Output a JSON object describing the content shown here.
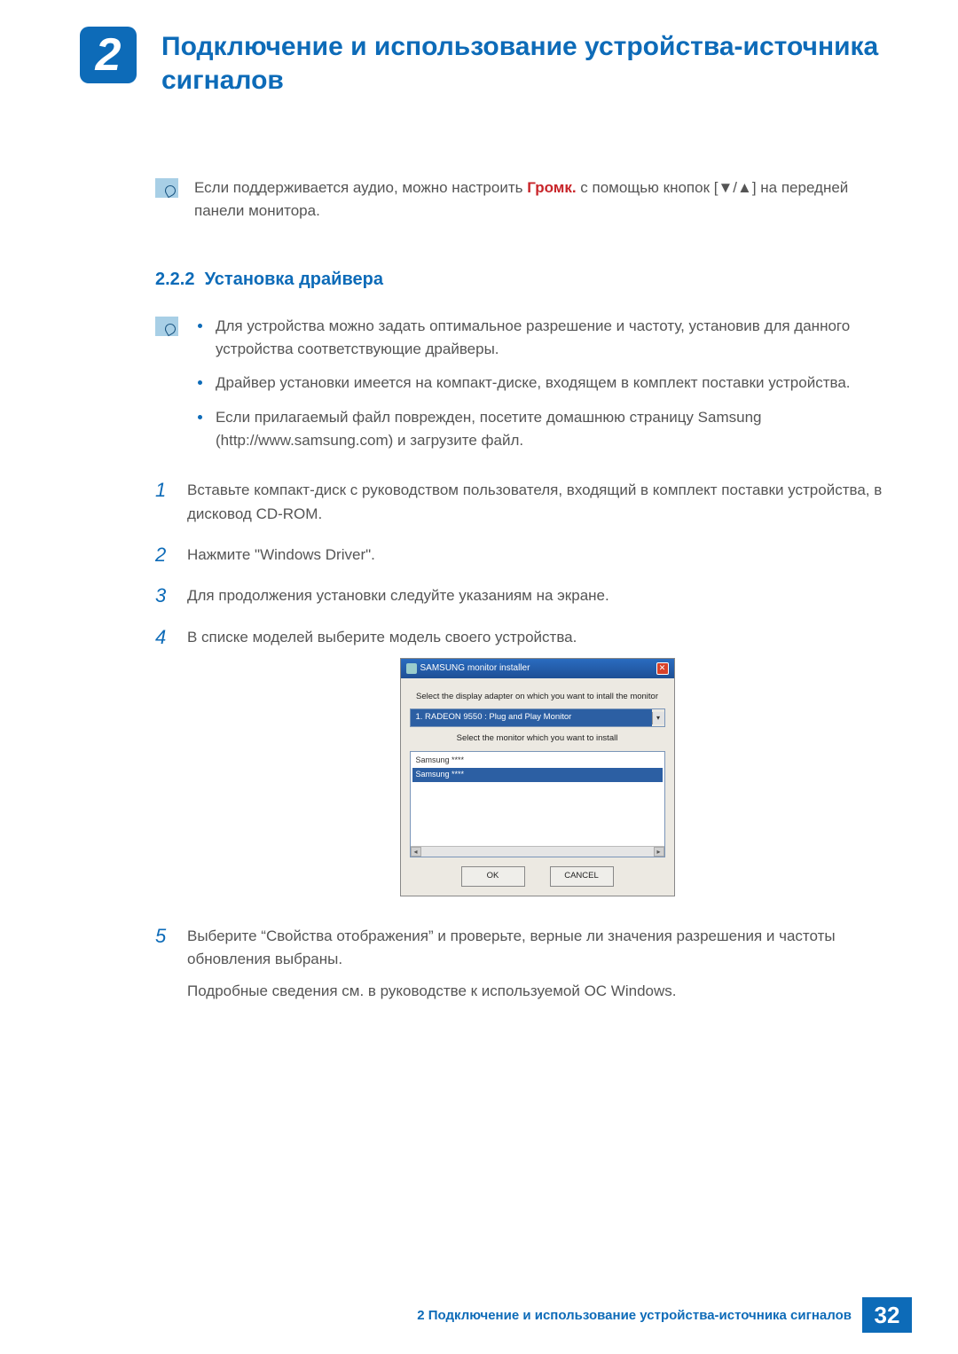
{
  "chapter": {
    "number": "2",
    "title": "Подключение и использование устройства-источника сигналов"
  },
  "intro_note": {
    "before": "Если поддерживается аудио, можно настроить ",
    "bold": "Громк.",
    "after_bold": " с помощью кнопок [",
    "symbols": "▼/▲",
    "end": "] на передней панели монитора."
  },
  "section": {
    "number": "2.2.2",
    "title": "Установка драйвера"
  },
  "bullets": [
    "Для устройства можно задать оптимальное разрешение и частоту, установив для данного устройства соответствующие драйверы.",
    "Драйвер установки имеется на компакт-диске, входящем в комплект поставки устройства.",
    "Если прилагаемый файл поврежден, посетите домашнюю страницу Samsung (http://www.samsung.com) и загрузите файл."
  ],
  "steps": [
    {
      "n": "1",
      "text": "Вставьте компакт-диск с руководством пользователя, входящий в комплект поставки устройства, в дисковод CD-ROM."
    },
    {
      "n": "2",
      "text": "Нажмите \"Windows Driver\"."
    },
    {
      "n": "3",
      "text": "Для продолжения установки следуйте указаниям на экране."
    },
    {
      "n": "4",
      "text": "В списке моделей выберите модель своего устройства."
    },
    {
      "n": "5",
      "text": "Выберите “Свойства отображения” и проверьте, верные ли значения разрешения и частоты обновления выбраны.",
      "extra": "Подробные сведения см. в руководстве к используемой ОС Windows."
    }
  ],
  "dialog": {
    "title": "SAMSUNG monitor installer",
    "label1": "Select the display adapter on which you want to intall the monitor",
    "adapter": "1. RADEON 9550 : Plug and Play Monitor",
    "label2": "Select the monitor which you want to install",
    "items": [
      "Samsung ****",
      "Samsung ****"
    ],
    "ok": "OK",
    "cancel": "CANCEL"
  },
  "footer": {
    "text": "2 Подключение и использование устройства-источника сигналов",
    "page": "32"
  }
}
